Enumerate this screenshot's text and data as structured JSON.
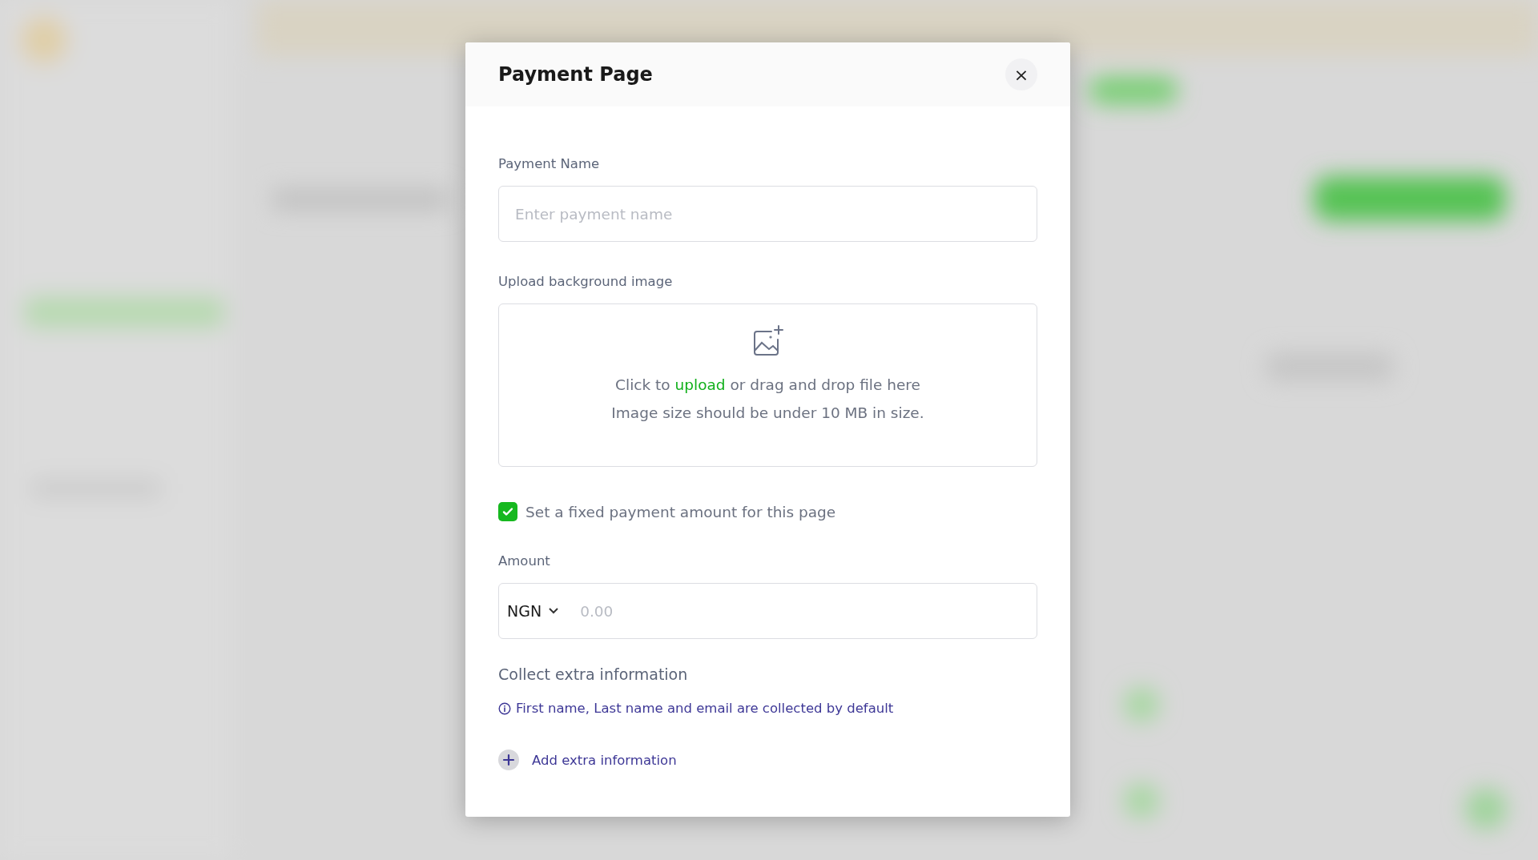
{
  "dialog": {
    "title": "Payment Page",
    "close_button": "×"
  },
  "payment_name": {
    "label": "Payment Name",
    "placeholder": "Enter payment name"
  },
  "upload": {
    "label": "Upload background image",
    "prompt_before": "Click to",
    "prompt_link": "upload",
    "prompt_after": "or drag and drop file here",
    "hint": "Image size should be under 10 MB in size."
  },
  "fixed_amount": {
    "label": "Set a fixed payment amount for this page",
    "checked": true
  },
  "amount": {
    "label": "Amount",
    "currency": "NGN",
    "placeholder": "0.00"
  },
  "extra_info": {
    "heading": "Collect extra information",
    "note": "First name, Last name and email are collected by default",
    "add_button": "Add extra information"
  }
}
